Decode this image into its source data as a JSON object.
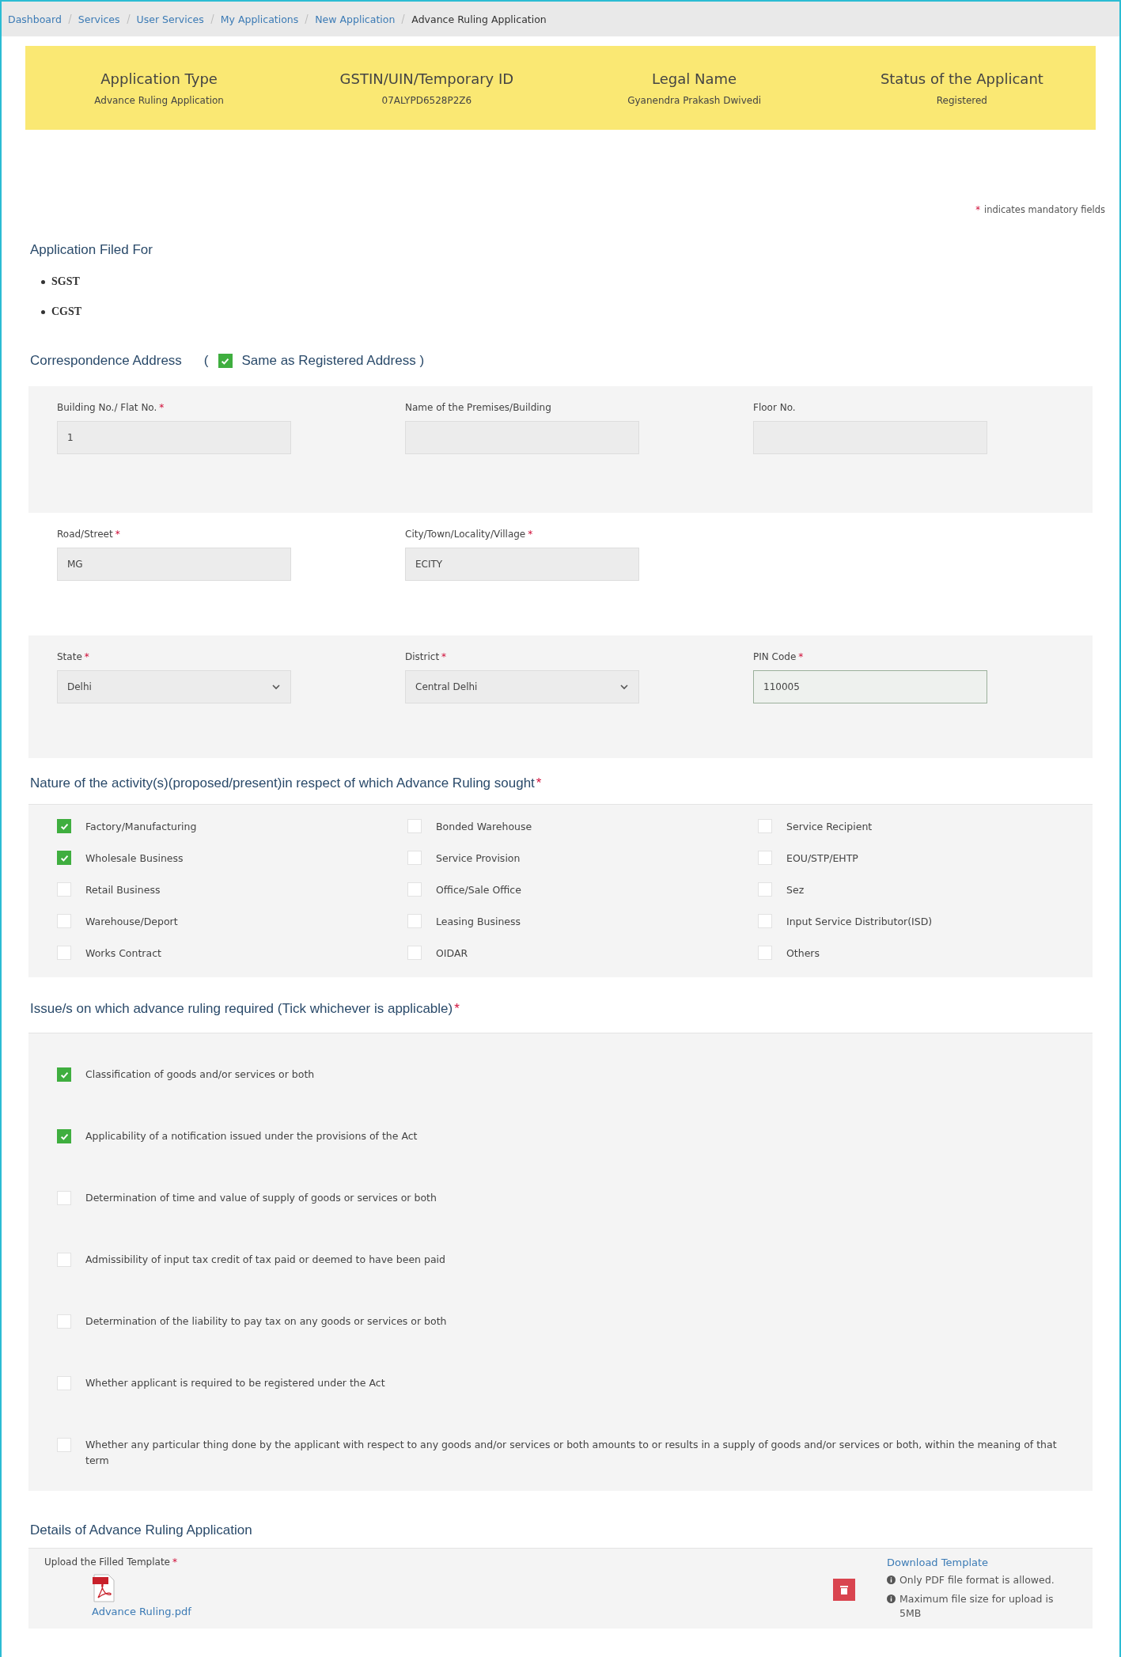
{
  "breadcrumb": [
    "Dashboard",
    "Services",
    "User Services",
    "My Applications",
    "New Application",
    "Advance Ruling Application"
  ],
  "summary": [
    {
      "title": "Application Type",
      "value": "Advance Ruling Application"
    },
    {
      "title": "GSTIN/UIN/Temporary ID",
      "value": "07ALYPD6528P2Z6"
    },
    {
      "title": "Legal Name",
      "value": "Gyanendra Prakash Dwivedi"
    },
    {
      "title": "Status of the Applicant",
      "value": "Registered"
    }
  ],
  "mandatory_note": {
    "mark": "*",
    "text": "indicates mandatory fields"
  },
  "filed_for": {
    "title": "Application Filed For",
    "items": [
      "SGST",
      "CGST"
    ]
  },
  "correspondence": {
    "title": "Correspondence Address",
    "open_paren": "(",
    "same_as_registered": {
      "checked": true,
      "label": "Same as Registered Address )"
    }
  },
  "address_rows": [
    {
      "fields": [
        {
          "kind": "text",
          "label": "Building No./ Flat No.",
          "mark": "*",
          "value": "1"
        },
        {
          "kind": "text",
          "label": "Name of the Premises/Building"
        },
        {
          "kind": "text",
          "label": "Floor No."
        }
      ]
    },
    {
      "fields": [
        {
          "kind": "text",
          "label": "Road/Street",
          "mark": "*",
          "value": "MG"
        },
        {
          "kind": "text",
          "label": "City/Town/Locality/Village",
          "mark": "*",
          "value": "ECITY"
        }
      ]
    },
    {
      "fields": [
        {
          "kind": "select",
          "label": "State",
          "mark": "*",
          "value": "Delhi"
        },
        {
          "kind": "select",
          "label": "District",
          "mark": "*",
          "value": "Central Delhi"
        },
        {
          "kind": "input",
          "label": "PIN Code",
          "mark": "*",
          "value": "110005"
        }
      ]
    }
  ],
  "activities": {
    "title": "Nature of the activity(s)(proposed/present)in respect of which Advance Ruling sought",
    "mark": "*",
    "items": [
      {
        "label": "Factory/Manufacturing",
        "checked": true
      },
      {
        "label": "Bonded Warehouse",
        "checked": false
      },
      {
        "label": "Service Recipient",
        "checked": false
      },
      {
        "label": "Wholesale Business",
        "checked": true
      },
      {
        "label": "Service Provision",
        "checked": false
      },
      {
        "label": "EOU/STP/EHTP",
        "checked": false
      },
      {
        "label": "Retail Business",
        "checked": false
      },
      {
        "label": "Office/Sale Office",
        "checked": false
      },
      {
        "label": "Sez",
        "checked": false
      },
      {
        "label": "Warehouse/Deport",
        "checked": false
      },
      {
        "label": "Leasing Business",
        "checked": false
      },
      {
        "label": "Input Service Distributor(ISD)",
        "checked": false
      },
      {
        "label": "Works Contract",
        "checked": false
      },
      {
        "label": "OIDAR",
        "checked": false
      },
      {
        "label": "Others",
        "checked": false
      }
    ]
  },
  "issues": {
    "title": "Issue/s on which advance ruling required (Tick whichever is applicable)",
    "mark": "*",
    "items": [
      {
        "label": "Classification of goods and/or services or both",
        "checked": true
      },
      {
        "label": "Applicability of a notification issued under the provisions of the Act",
        "checked": true
      },
      {
        "label": "Determination of time and value of supply of goods or services or both",
        "checked": false
      },
      {
        "label": "Admissibility of input tax credit of tax paid or deemed to have been paid",
        "checked": false
      },
      {
        "label": "Determination of the liability to pay tax on any goods or services or both",
        "checked": false
      },
      {
        "label": "Whether applicant is required to be registered under the Act",
        "checked": false
      },
      {
        "label": "Whether any particular thing done by the applicant with respect to any goods and/or services or both amounts to or results in a supply of goods and/or services or both, within the meaning of that term",
        "checked": false
      }
    ]
  },
  "details": {
    "title": "Details of Advance Ruling Application",
    "upload_label": "Upload the Filled Template",
    "mark": "*",
    "file_name": "Advance Ruling.pdf",
    "download_link": "Download Template",
    "notes": [
      "Only PDF file format is allowed.",
      "Maximum file size for upload is 5MB"
    ]
  }
}
